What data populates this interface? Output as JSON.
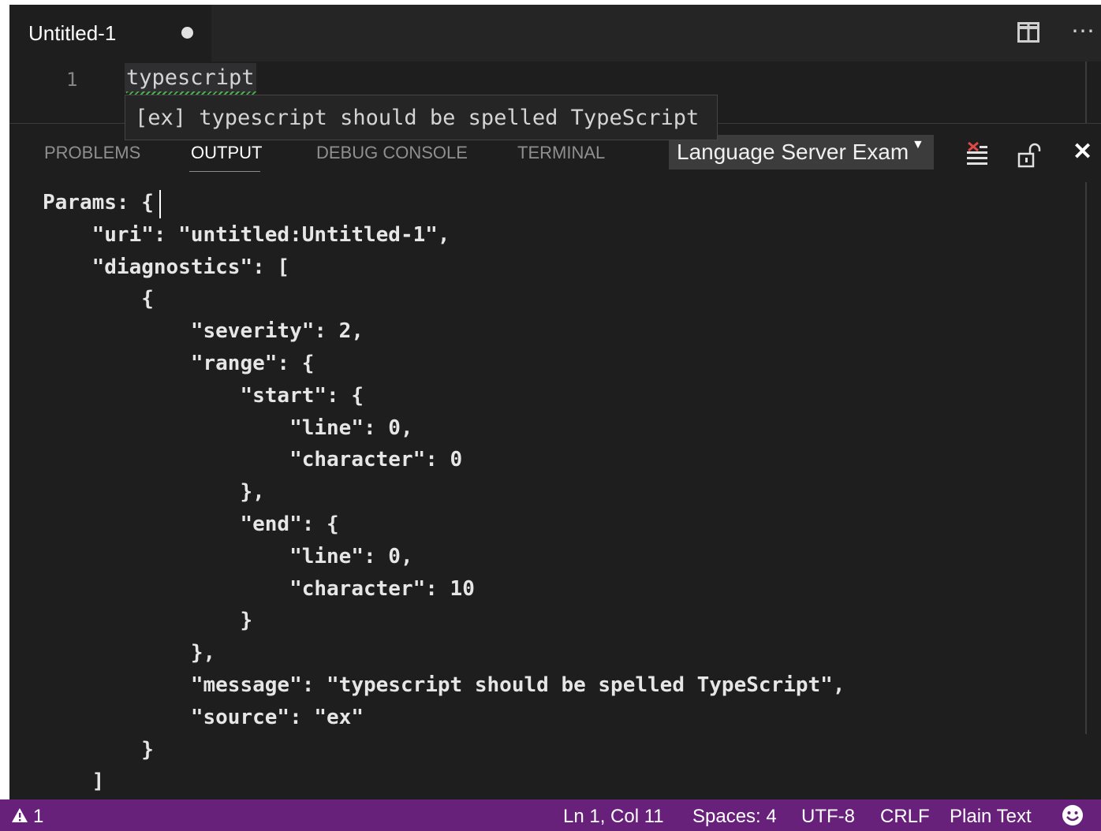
{
  "editor": {
    "tab_title": "Untitled-1",
    "line_number": "1",
    "line_text": "typescript",
    "hover_text": "[ex] typescript should be spelled TypeScript"
  },
  "panel": {
    "tabs": [
      "PROBLEMS",
      "OUTPUT",
      "DEBUG CONSOLE",
      "TERMINAL"
    ],
    "active_tab": "OUTPUT",
    "channel": "Language Server Exam",
    "output_lines": [
      "Params: {",
      "    \"uri\": \"untitled:Untitled-1\",",
      "    \"diagnostics\": [",
      "        {",
      "            \"severity\": 2,",
      "            \"range\": {",
      "                \"start\": {",
      "                    \"line\": 0,",
      "                    \"character\": 0",
      "                },",
      "                \"end\": {",
      "                    \"line\": 0,",
      "                    \"character\": 10",
      "                }",
      "            },",
      "            \"message\": \"typescript should be spelled TypeScript\",",
      "            \"source\": \"ex\"",
      "        }",
      "    ]"
    ]
  },
  "statusbar": {
    "warnings": "1",
    "position": "Ln 1, Col 11",
    "indent": "Spaces: 4",
    "encoding": "UTF-8",
    "eol": "CRLF",
    "language": "Plain Text"
  },
  "colors": {
    "statusbar": "#68217a",
    "editor_bg": "#1e1e1e",
    "squiggle": "#4caf50"
  }
}
